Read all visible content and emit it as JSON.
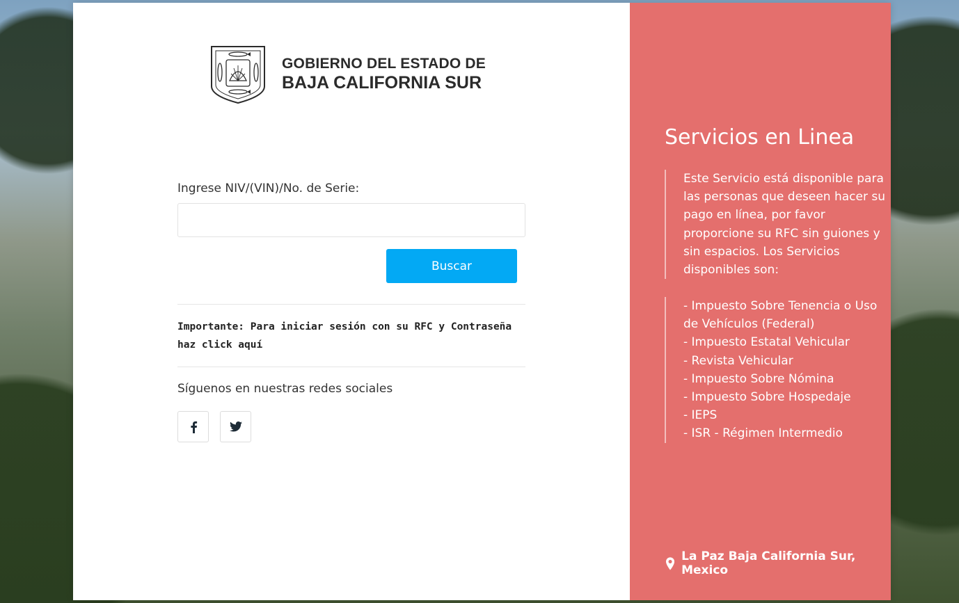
{
  "header": {
    "logo_line1": "GOBIERNO DEL ESTADO DE",
    "logo_line2": "BAJA CALIFORNIA SUR"
  },
  "form": {
    "label": "Ingrese NIV/(VIN)/No. de Serie:",
    "input_value": "",
    "button_label": "Buscar"
  },
  "notice": {
    "text": "Importante: Para iniciar sesión con su RFC y Contraseña haz click aquí"
  },
  "social": {
    "label": "Síguenos en nuestras redes sociales",
    "icons": [
      "facebook-icon",
      "twitter-icon"
    ]
  },
  "panel": {
    "title": "Servicios en Linea",
    "description": "Este Servicio está disponible para las personas que deseen hacer su pago en línea, por favor proporcione su RFC sin guiones y sin espacios. Los Servicios disponibles son:",
    "services": [
      "- Impuesto Sobre Tenencia o Uso de Vehículos (Federal)",
      "- Impuesto Estatal Vehicular",
      "- Revista Vehicular",
      "- Impuesto Sobre Nómina",
      "- Impuesto Sobre Hospedaje",
      "- IEPS",
      "- ISR - Régimen Intermedio"
    ],
    "location": "La Paz Baja California Sur, Mexico",
    "location_icon": "map-marker-icon"
  },
  "colors": {
    "panel_bg": "#e46f6d",
    "button_bg": "#03a9f4",
    "text": "#333333"
  }
}
